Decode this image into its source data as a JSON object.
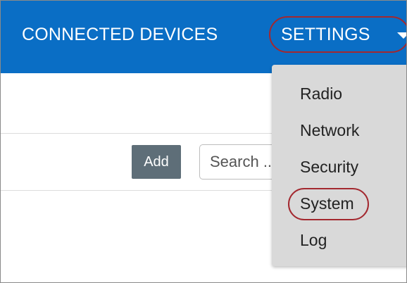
{
  "nav": {
    "connected_devices": "CONNECTED DEVICES",
    "settings": "SETTINGS",
    "settings_caret_icon": "caret-down"
  },
  "toolbar": {
    "add_label": "Add",
    "search_placeholder": "Search ..."
  },
  "settings_menu": {
    "items": [
      {
        "label": "Radio"
      },
      {
        "label": "Network"
      },
      {
        "label": "Security"
      },
      {
        "label": "System"
      },
      {
        "label": "Log"
      }
    ]
  },
  "colors": {
    "navbar": "#0a6ec5",
    "highlight": "#a3282f",
    "add_button": "#5e6e78",
    "dropdown_bg": "#d9d9d9"
  }
}
